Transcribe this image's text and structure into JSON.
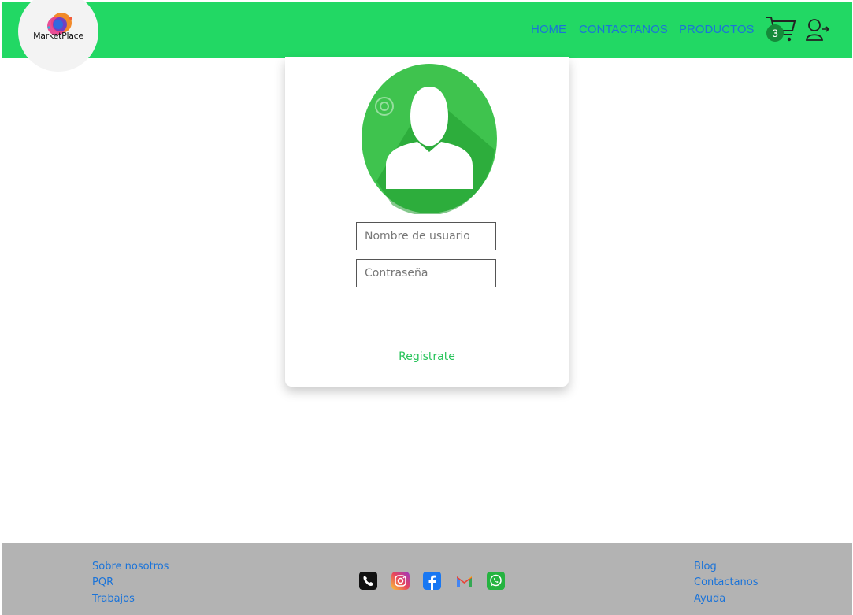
{
  "brand": {
    "name": "MarketPlace"
  },
  "nav": {
    "home": "HOME",
    "contact": "CONTACTANOS",
    "products": "PRODUCTOS"
  },
  "cart": {
    "count": "3"
  },
  "login": {
    "username_placeholder": "Nombre de usuario",
    "password_placeholder": "Contraseña",
    "register": "Registrate"
  },
  "footer": {
    "left": [
      "Sobre nosotros",
      "PQR",
      "Trabajos"
    ],
    "right": [
      "Blog",
      "Contactanos",
      "Ayuda"
    ],
    "social": [
      "phone-icon",
      "instagram-icon",
      "facebook-icon",
      "gmail-icon",
      "whatsapp-icon"
    ]
  },
  "colors": {
    "header": "#22d864",
    "link": "#1a73d9",
    "footer": "#b3b3b3",
    "accent": "#27c35a"
  }
}
